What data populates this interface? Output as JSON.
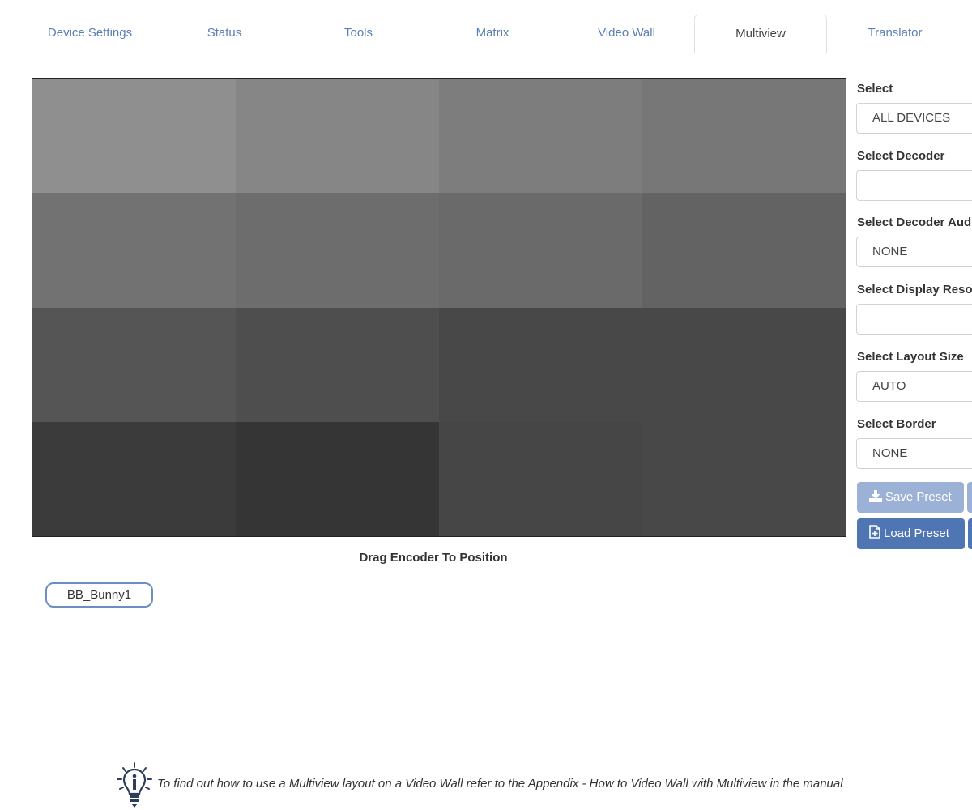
{
  "tabs": [
    {
      "label": "Device Settings",
      "active": false
    },
    {
      "label": "Status",
      "active": false
    },
    {
      "label": "Tools",
      "active": false
    },
    {
      "label": "Matrix",
      "active": false
    },
    {
      "label": "Video Wall",
      "active": false
    },
    {
      "label": "Multiview",
      "active": true
    },
    {
      "label": "Translator",
      "active": false
    }
  ],
  "grid": {
    "cell_colors": [
      "#8f8f8f",
      "#868686",
      "#7d7d7d",
      "#777777",
      "#727272",
      "#6d6d6d",
      "#6a6a6a",
      "#636363",
      "#555555",
      "#4e4e4e",
      "#484848",
      "#484848",
      "#3b3b3b",
      "#353535",
      "#464646",
      "#484848"
    ],
    "caption": "Drag Encoder To Position"
  },
  "encoders": [
    {
      "label": "BB_Bunny1"
    }
  ],
  "panel": {
    "select_label": "Select",
    "select_value": "ALL DEVICES",
    "decoder_label": "Select Decoder",
    "decoder_value": "",
    "decoder_audio_label": "Select Decoder Audio",
    "decoder_audio_value": "NONE",
    "display_resolution_label": "Select Display Resolution",
    "display_resolution_value": "",
    "layout_size_label": "Select Layout Size",
    "layout_size_value": "AUTO",
    "border_label": "Select Border",
    "border_value": "NONE",
    "save_preset_label": "Save Preset",
    "load_preset_label": "Load Preset"
  },
  "tip": {
    "icon": "lightbulb-info-icon",
    "text": "To find out how to use a Multiview layout on a Video Wall refer to the Appendix - How to Video Wall with Multiview in the manual"
  },
  "colors": {
    "tab_link": "#5a7fb5",
    "primary_button": "#4f75b3",
    "disabled_button": "#9bb2d6",
    "chip_border": "#6d8fbf"
  }
}
